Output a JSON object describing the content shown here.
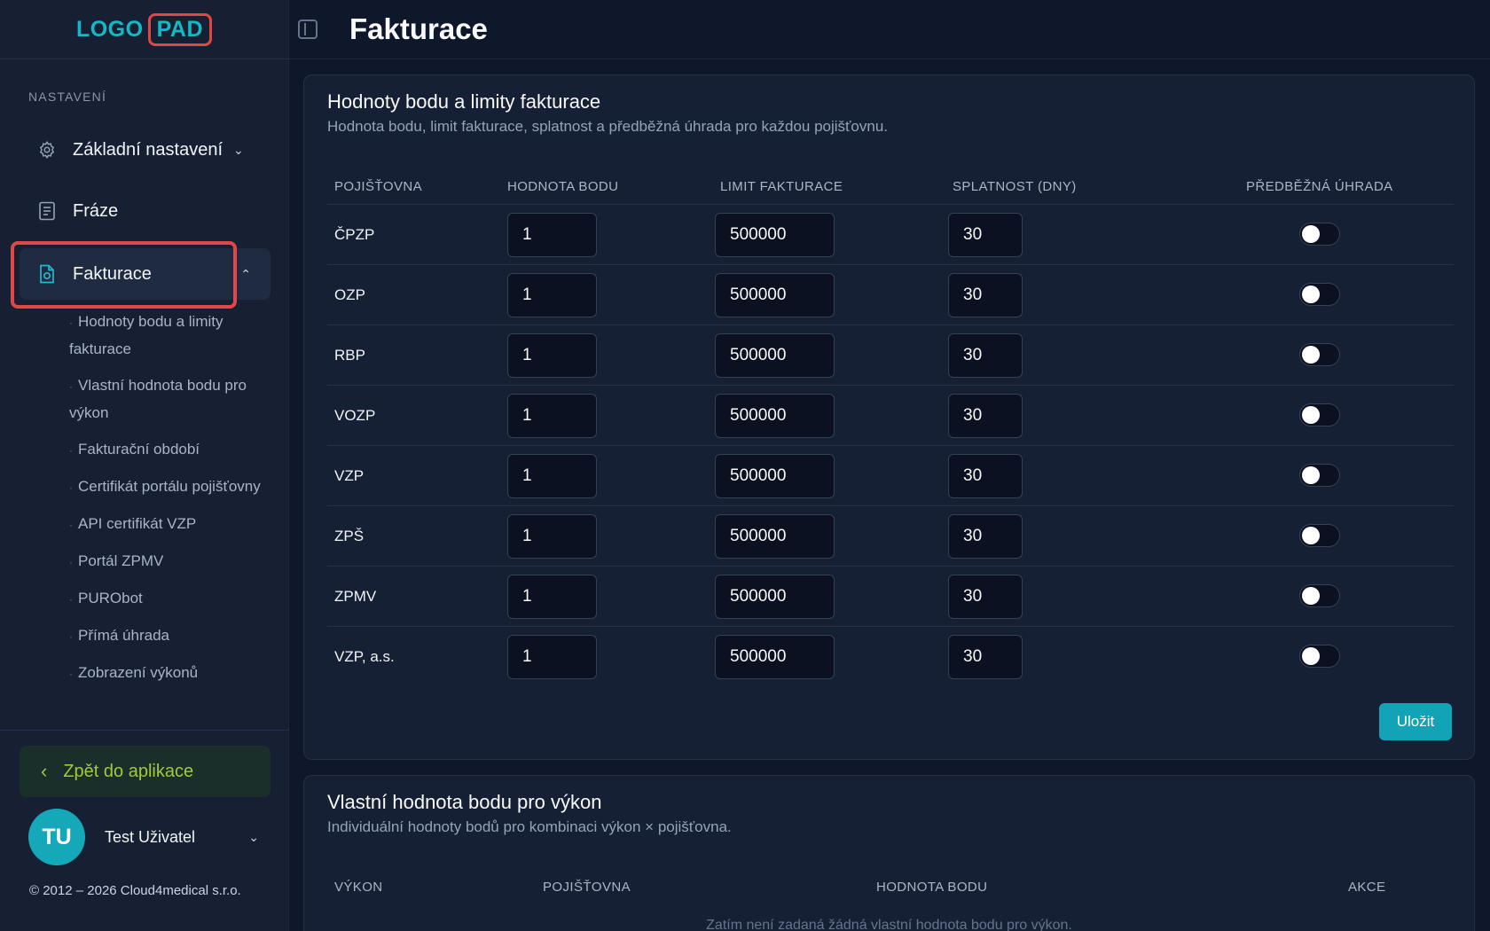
{
  "brand": {
    "logo_left": "LOGO",
    "logo_right": "PAD"
  },
  "header": {
    "title": "Fakturace"
  },
  "sidebar": {
    "section_label": "NASTAVENÍ",
    "items": [
      {
        "label": "Základní nastavení",
        "icon": "gear-icon"
      },
      {
        "label": "Fráze",
        "icon": "document-icon"
      },
      {
        "label": "Fakturace",
        "icon": "invoice-icon"
      }
    ],
    "sub_items": [
      "Hodnoty bodu a limity fakturace",
      "Vlastní hodnota bodu pro výkon",
      "Fakturační období",
      "Certifikát portálu pojišťovny",
      "API certifikát VZP",
      "Portál ZPMV",
      "PURObot",
      "Přímá úhrada",
      "Zobrazení výkonů"
    ],
    "back_label": "Zpět do aplikace",
    "user": {
      "initials": "TU",
      "name": "Test Uživatel"
    },
    "copyright": "© 2012 – 2026 Cloud4medical s.r.o."
  },
  "limits_card": {
    "title": "Hodnoty bodu a limity fakturace",
    "subtitle": "Hodnota bodu, limit fakturace, splatnost a předběžná úhrada pro každou pojišťovnu.",
    "columns": [
      "POJIŠŤOVNA",
      "HODNOTA BODU",
      "LIMIT FAKTURACE",
      "SPLATNOST (DNY)",
      "PŘEDBĚŽNÁ ÚHRADA"
    ],
    "rows": [
      {
        "name": "ČPZP",
        "point_value": "1",
        "limit": "500000",
        "due_days": "30",
        "prepayment": false
      },
      {
        "name": "OZP",
        "point_value": "1",
        "limit": "500000",
        "due_days": "30",
        "prepayment": false
      },
      {
        "name": "RBP",
        "point_value": "1",
        "limit": "500000",
        "due_days": "30",
        "prepayment": false
      },
      {
        "name": "VOZP",
        "point_value": "1",
        "limit": "500000",
        "due_days": "30",
        "prepayment": false
      },
      {
        "name": "VZP",
        "point_value": "1",
        "limit": "500000",
        "due_days": "30",
        "prepayment": false
      },
      {
        "name": "ZPŠ",
        "point_value": "1",
        "limit": "500000",
        "due_days": "30",
        "prepayment": false
      },
      {
        "name": "ZPMV",
        "point_value": "1",
        "limit": "500000",
        "due_days": "30",
        "prepayment": false
      },
      {
        "name": "VZP, a.s.",
        "point_value": "1",
        "limit": "500000",
        "due_days": "30",
        "prepayment": false
      }
    ],
    "save_label": "Uložit"
  },
  "custom_card": {
    "title": "Vlastní hodnota bodu pro výkon",
    "subtitle": "Individuální hodnoty bodů pro kombinaci výkon × pojišťovna.",
    "columns": [
      "VÝKON",
      "POJIŠŤOVNA",
      "HODNOTA BODU",
      "AKCE"
    ],
    "empty_text": "Zatím není zadaná žádná vlastní hodnota bodu pro výkon."
  }
}
